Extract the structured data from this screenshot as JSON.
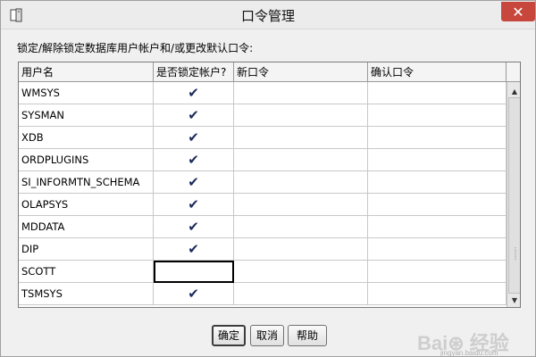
{
  "window": {
    "title": "口令管理",
    "close_glyph": "✕"
  },
  "instruction": "锁定/解除锁定数据库用户帐户和/或更改默认口令:",
  "table": {
    "headers": [
      "用户名",
      "是否锁定帐户?",
      "新口令",
      "确认口令"
    ],
    "rows": [
      {
        "user": "WMSYS",
        "locked": true
      },
      {
        "user": "SYSMAN",
        "locked": true
      },
      {
        "user": "XDB",
        "locked": true
      },
      {
        "user": "ORDPLUGINS",
        "locked": true
      },
      {
        "user": "SI_INFORMTN_SCHEMA",
        "locked": true
      },
      {
        "user": "OLAPSYS",
        "locked": true
      },
      {
        "user": "MDDATA",
        "locked": true
      },
      {
        "user": "DIP",
        "locked": true
      },
      {
        "user": "SCOTT",
        "locked": false
      },
      {
        "user": "TSMSYS",
        "locked": true
      }
    ],
    "check_glyph": "✔"
  },
  "buttons": {
    "ok": "确定",
    "cancel": "取消",
    "help": "帮助"
  },
  "watermark": {
    "logo": "Bai⊛ 经验",
    "sub": "jingyan.baidu.com"
  },
  "icons": {
    "app": "app-icon",
    "close": "close-icon",
    "scroll_up": "scroll-up-arrow-icon",
    "scroll_down": "scroll-down-arrow-icon"
  },
  "colors": {
    "close_button": "#c7473d",
    "check": "#1c2a5a"
  }
}
